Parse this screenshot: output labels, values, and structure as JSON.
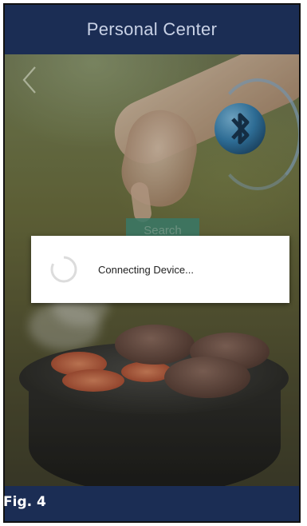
{
  "header": {
    "title": "Personal Center"
  },
  "background": {
    "search_button_label": "Search"
  },
  "dialog": {
    "message": "Connecting Device..."
  },
  "caption": {
    "label": "Fig. 4"
  },
  "colors": {
    "header_bg": "#1b2d54",
    "bluetooth_blue": "#2f7fb5",
    "dialog_bg": "#ffffff"
  },
  "icons": {
    "back": "chevron-left-icon",
    "bluetooth": "bluetooth-icon",
    "spinner": "loading-spinner-icon"
  }
}
